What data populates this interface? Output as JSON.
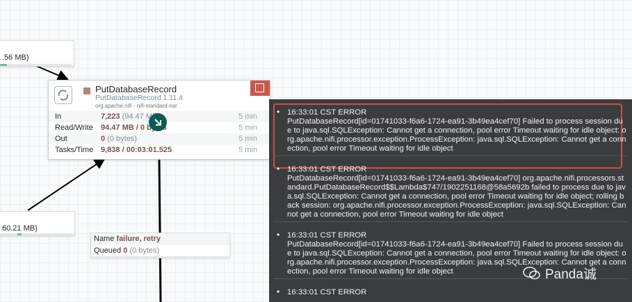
{
  "top_connection": {
    "text": ".56 MB)"
  },
  "left_connection": {
    "text": "60.21 MB)"
  },
  "processor": {
    "name": "PutDatabaseRecord",
    "type": "PutDatabaseRecord 1.11.4",
    "bundle": "org.apache.nifi - nifi-standard-nar",
    "stats": [
      {
        "label": "In",
        "value": "7,223",
        "extra": " (94.47 MB)",
        "time": "5 min"
      },
      {
        "label": "Read/Write",
        "value": "94.47 MB / 0 bytes",
        "extra": "",
        "time": "5 min"
      },
      {
        "label": "Out",
        "value": "0",
        "extra": " (0 bytes)",
        "time": "5 min"
      },
      {
        "label": "Tasks/Time",
        "value": "9,838 / 00:03:01.525",
        "extra": "",
        "time": "5 min"
      }
    ]
  },
  "relationship": {
    "name_label": "Name",
    "name_value": "failure, retry",
    "queued_label": "Queued",
    "queued_value": "0",
    "queued_extra": " (0 bytes)"
  },
  "bulletins": [
    {
      "header": "16:33:01 CST   ERROR",
      "message": "PutDatabaseRecord[id=01741033-f6a6-1724-ea91-3b49ea4cef70] Failed to process session due to java.sql.SQLException: Cannot get a connection, pool error Timeout waiting for idle object: org.apache.nifi.processor.exception.ProcessException: java.sql.SQLException: Cannot get a connection, pool error Timeout waiting for idle object"
    },
    {
      "header": "16:33:01 CST   ERROR",
      "message": "PutDatabaseRecord[id=01741033-f6a6-1724-ea91-3b49ea4cef70] org.apache.nifi.processors.standard.PutDatabaseRecord$$Lambda$747/1902251168@58a5692b failed to process due to java.sql.SQLException: Cannot get a connection, pool error Timeout waiting for idle object; rolling back session: org.apache.nifi.processor.exception.ProcessException: java.sql.SQLException: Cannot get a connection, pool error Timeout waiting for idle object"
    },
    {
      "header": "16:33:01 CST   ERROR",
      "message": "PutDatabaseRecord[id=01741033-f6a6-1724-ea91-3b49ea4cef70] Failed to process session due to java.sql.SQLException: Cannot get a connection, pool error Timeout waiting for idle object: org.apache.nifi.processor.exception.ProcessException: java.sql.SQLException: Cannot get a connection, pool error Timeout waiting for idle object"
    },
    {
      "header": "16:33:01 CST   ERROR",
      "message": ""
    }
  ],
  "watermark": {
    "text": "Panda诚"
  },
  "colors": {
    "bulletin_bg": "#3a3d3e",
    "error_highlight": "#d24a4f",
    "stopped": "#b8817e",
    "badge": "#0d5a55"
  }
}
